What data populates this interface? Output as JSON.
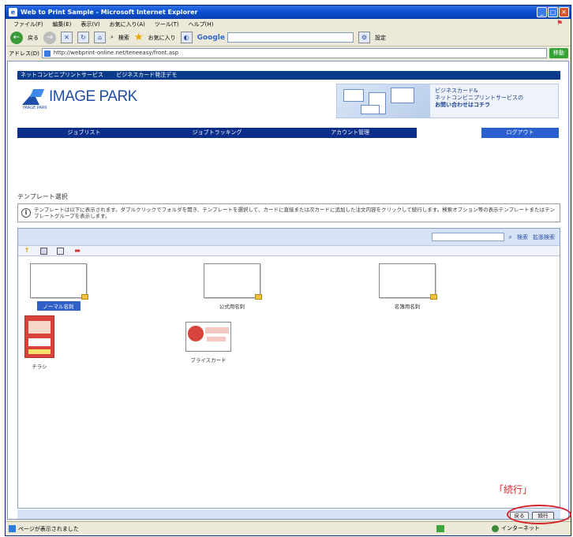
{
  "window": {
    "title": "Web to Print Sample - Microsoft Internet Explorer",
    "minimize": "_",
    "maximize": "□",
    "close": "✕"
  },
  "menubar": {
    "items": [
      "ファイル(F)",
      "編集(E)",
      "表示(V)",
      "お気に入り(A)",
      "ツール(T)",
      "ヘルプ(H)"
    ]
  },
  "toolbar": {
    "back_label": "戻る",
    "search_label": "検索",
    "favorites_label": "お気に入り",
    "google_label": "Google",
    "settings_label": "設定"
  },
  "addressbar": {
    "label": "アドレス(D)",
    "url": "http://webprint-online.net/teneeasy/front.asp",
    "go_label": "移動"
  },
  "site": {
    "top_nav": [
      "ネットコンビニプリントサービス",
      "ビジネスカード発注デモ"
    ],
    "logo_name": "IMAGE PARK",
    "logo_sub": "IMAGE PARK",
    "banner_lines": [
      "ビジネスカード&",
      "ネットコンビニプリントサービスの"
    ],
    "banner_cta": "お問い合わせはコチラ",
    "main_nav": [
      "ジョブリスト",
      "ジョブトラッキング",
      "アカウント管理"
    ],
    "logout_label": "ログアウト"
  },
  "section": {
    "title": "テンプレート選択",
    "info_icon": "i",
    "info_text": "テンプレートは以下に表示されます。ダブルクリックでフォルダを開き、テンプレートを選択して、カードに直接または次カードに追加した注文内容をクリックして続行します。検索オプション等の表示テンプレートまたはテンプレートグループを表示します。"
  },
  "panel": {
    "search_placeholder": "",
    "search_label": "検索",
    "advanced_label": "拡張検索",
    "templates": [
      {
        "label": "ノーマル名刺",
        "selected": true
      },
      {
        "label": "公式用名刺",
        "selected": false
      },
      {
        "label": "名簿用名刺",
        "selected": false
      },
      {
        "label": "チラシ",
        "selected": false
      },
      {
        "label": "プライスカード",
        "selected": false
      }
    ]
  },
  "footer_buttons": {
    "back_label": "戻る",
    "continue_label": "続行"
  },
  "annotation": {
    "callout": "「続行」",
    "color": "#d4232b"
  },
  "statusbar": {
    "text": "ページが表示されました",
    "zone": "インターネット"
  }
}
